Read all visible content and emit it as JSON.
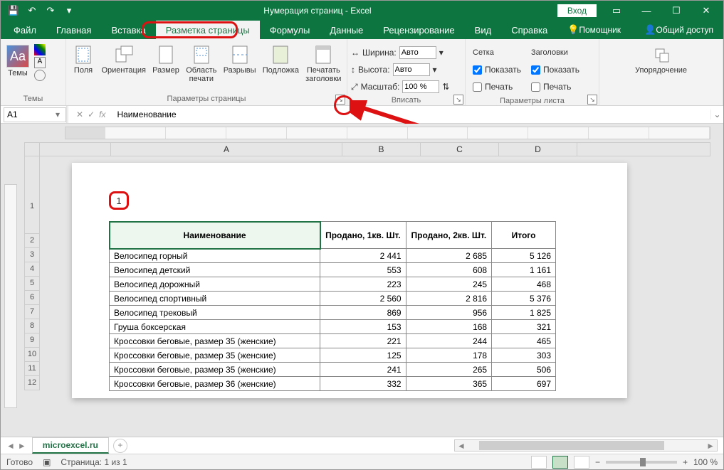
{
  "title": "Нумерация страниц - Excel",
  "login": "Вход",
  "qat": {
    "save": "💾",
    "undo": "↶",
    "redo": "↷"
  },
  "tabs": {
    "file": "Файл",
    "home": "Главная",
    "insert": "Вставка",
    "layout": "Разметка страницы",
    "formulas": "Формулы",
    "data": "Данные",
    "review": "Рецензирование",
    "view": "Вид",
    "help": "Справка",
    "assistant": "Помощник",
    "share": "Общий доступ"
  },
  "ribbon": {
    "themes": {
      "group": "Темы",
      "themes": "Темы"
    },
    "page_setup": {
      "group": "Параметры страницы",
      "margins": "Поля",
      "orientation": "Ориентация",
      "size": "Размер",
      "print_area": "Область\nпечати",
      "breaks": "Разрывы",
      "background": "Подложка",
      "print_titles": "Печатать\nзаголовки"
    },
    "scale": {
      "group": "Вписать",
      "width": "Ширина:",
      "height": "Высота:",
      "scale": "Масштаб:",
      "auto": "Авто",
      "scale_val": "100 %"
    },
    "sheet_opts": {
      "group": "Параметры листа",
      "gridlines": "Сетка",
      "headings": "Заголовки",
      "show": "Показать",
      "print": "Печать"
    },
    "arrange": {
      "group": " ",
      "arrange": "Упорядочение"
    }
  },
  "namebox": "A1",
  "formula": "Наименование",
  "page_number": "1",
  "columns": [
    "A",
    "B",
    "C",
    "D"
  ],
  "headers": [
    "Наименование",
    "Продано, 1кв. Шт.",
    "Продано, 2кв. Шт.",
    "Итого"
  ],
  "rows": [
    [
      "Велосипед горный",
      "2 441",
      "2 685",
      "5 126"
    ],
    [
      "Велосипед детский",
      "553",
      "608",
      "1 161"
    ],
    [
      "Велосипед дорожный",
      "223",
      "245",
      "468"
    ],
    [
      "Велосипед спортивный",
      "2 560",
      "2 816",
      "5 376"
    ],
    [
      "Велосипед трековый",
      "869",
      "956",
      "1 825"
    ],
    [
      "Груша боксерская",
      "153",
      "168",
      "321"
    ],
    [
      "Кроссовки беговые, размер 35 (женские)",
      "221",
      "244",
      "465"
    ],
    [
      "Кроссовки беговые, размер 35 (женские)",
      "125",
      "178",
      "303"
    ],
    [
      "Кроссовки беговые, размер 35 (женские)",
      "241",
      "265",
      "506"
    ],
    [
      "Кроссовки беговые, размер 36 (женские)",
      "332",
      "365",
      "697"
    ]
  ],
  "row_numbers": [
    "1",
    "2",
    "3",
    "4",
    "5",
    "6",
    "7",
    "8",
    "9",
    "10",
    "11",
    "12"
  ],
  "sheet_tab": "microexcel.ru",
  "status": {
    "ready": "Готово",
    "page": "Страница: 1 из 1",
    "zoom": "100 %"
  }
}
